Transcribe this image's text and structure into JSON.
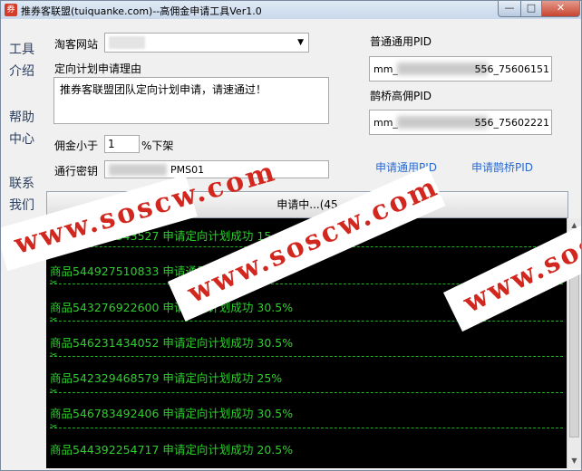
{
  "window": {
    "title": "推券客联盟(tuiquanke.com)--高佣金申请工具Ver1.0",
    "min_label": "—",
    "max_label": "□",
    "close_label": "✕"
  },
  "sidebar": {
    "items": [
      {
        "line1": "工具",
        "line2": "介绍"
      },
      {
        "line1": "帮助",
        "line2": "中心"
      },
      {
        "line1": "联系",
        "line2": "我们"
      }
    ]
  },
  "form": {
    "taoke_label": "淘客网站",
    "reason_label": "定向计划申请理由",
    "reason_value": "推券客联盟团队定向计划申请，请速通过！",
    "commission_prefix": "佣金小于",
    "commission_value": "1",
    "commission_suffix": "%下架",
    "key_label": "通行密钥",
    "key_visible": "PMS01"
  },
  "pid": {
    "normal_label": "普通通用PID",
    "normal_prefix": "mm_",
    "normal_suffix": "556_75606151",
    "queqiao_label": "鹊桥高佣PID",
    "queqiao_prefix": "mm_",
    "queqiao_suffix": "556_75602221",
    "apply_normal": "申请通用PID",
    "apply_queqiao": "申请鹊桥PID"
  },
  "main_button": "申请中...(45",
  "log": {
    "entries": [
      "商品520931343527 申请定向计划成功 15",
      "商品544927510833 申请通用计划成功 30%",
      "商品543276922600 申请定向计划成功 30.5%",
      "商品546231434052 申请定向计划成功 30.5%",
      "商品542329468579 申请定向计划成功 25%",
      "商品546783492406 申请定向计划成功 30.5%",
      "商品544392254717 申请定向计划成功 20.5%"
    ],
    "separator_icon": "scissors-icon"
  },
  "watermark": "www.soscw.com",
  "colors": {
    "log_text": "#2bd12b",
    "link": "#2a6bd4",
    "watermark": "#d1271f"
  }
}
